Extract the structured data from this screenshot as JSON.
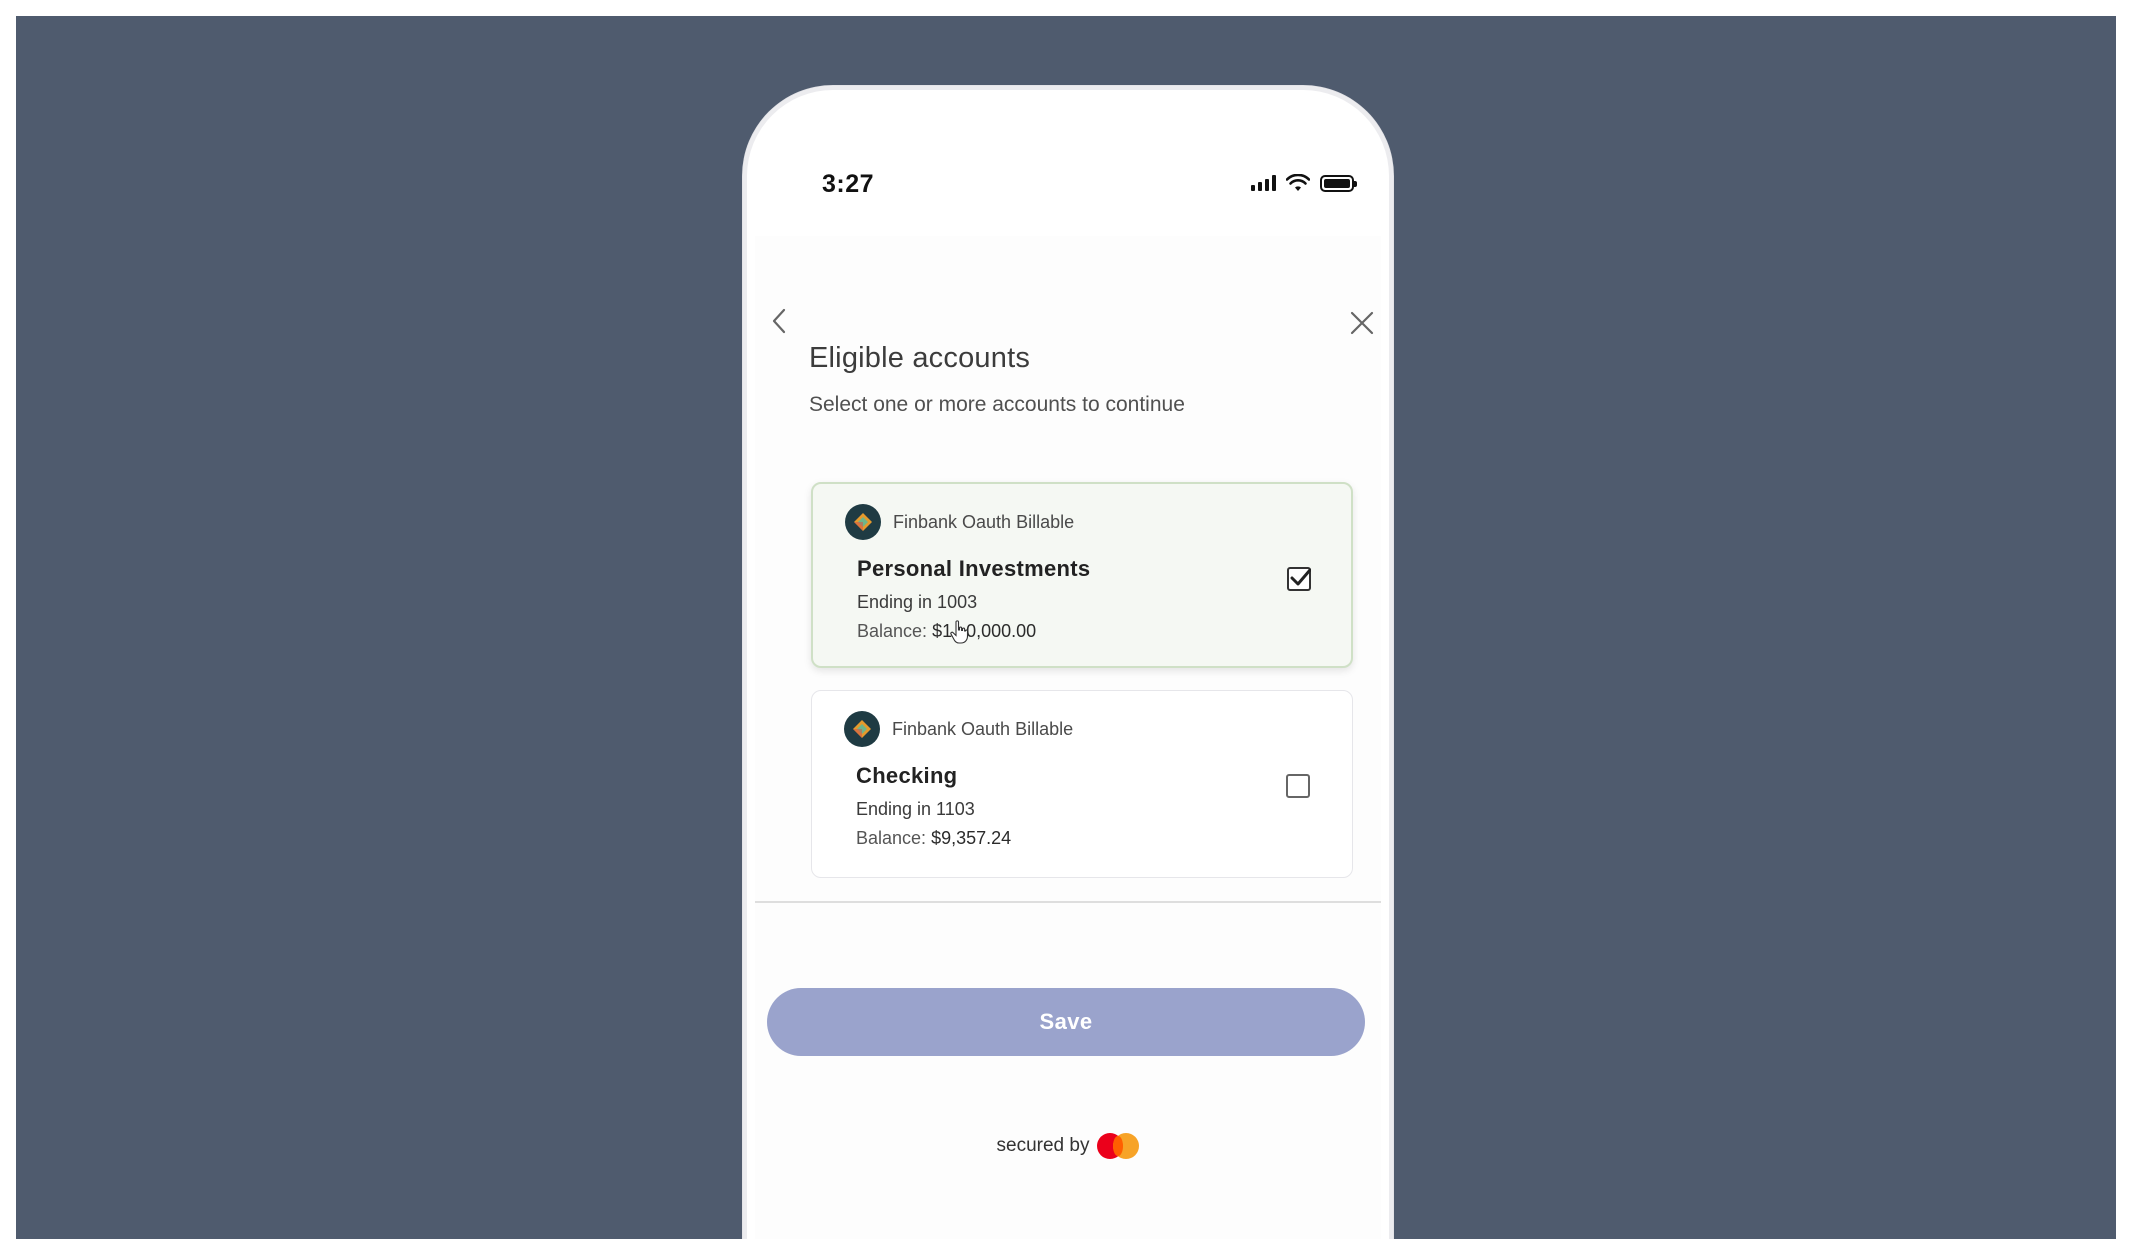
{
  "status_bar": {
    "time": "3:27",
    "icons": [
      "signal-icon",
      "wifi-icon",
      "battery-icon"
    ]
  },
  "header": {
    "back_icon": "chevron-left-icon",
    "close_icon": "close-icon",
    "title": "Eligible accounts",
    "subtitle": "Select one or more accounts to continue"
  },
  "accounts": [
    {
      "bank": "Finbank Oauth Billable",
      "name": "Personal Investments",
      "ending": "Ending in 1003",
      "balance_label": "Balance:",
      "balance_value": "$1",
      "balance_value_rest": "0,000.00",
      "checked": true
    },
    {
      "bank": "Finbank Oauth Billable",
      "name": "Checking",
      "ending": "Ending in 1103",
      "balance_label": "Balance:",
      "balance_value": "$9,357.24",
      "checked": false
    }
  ],
  "actions": {
    "save_label": "Save"
  },
  "footer": {
    "secured_text": "secured by",
    "logo": "mastercard-logo"
  },
  "colors": {
    "backdrop": "#4f5b6e",
    "save_button": "#9aa3cc",
    "selected_card_bg": "#f5f8f3",
    "bank_logo_bg": "#1f3b43"
  }
}
